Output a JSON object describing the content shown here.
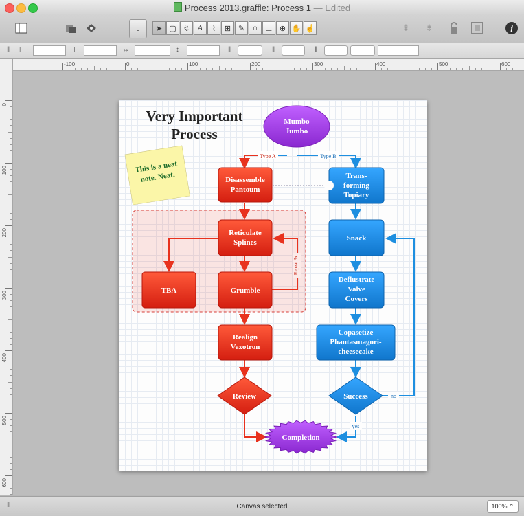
{
  "window": {
    "title": "Process 2013.graffle: Process 1",
    "title_suffix": "— Edited"
  },
  "toolbar": {
    "left_icons": [
      "sidebar-icon",
      "canvas-icon",
      "layers-icon",
      "style-icon"
    ],
    "tools": [
      "pointer",
      "shape",
      "line",
      "text",
      "pen",
      "diagram",
      "style-brush",
      "magnet",
      "rubber-stamp",
      "zoom",
      "hand",
      "browse"
    ],
    "right_icons": [
      "bring-front-icon",
      "send-back-icon",
      "lock-icon",
      "group-icon",
      "inspector-icon"
    ]
  },
  "ruler": {
    "x_labels": [
      "-100",
      "0",
      "100",
      "200",
      "300",
      "400",
      "500",
      "600"
    ],
    "y_labels": [
      "0",
      "100",
      "200",
      "300",
      "400",
      "500",
      "600"
    ]
  },
  "diagram": {
    "title_line1": "Very Important",
    "title_line2": "Process",
    "note_line1": "This is a neat",
    "note_line2": "note. Neat.",
    "nodes": {
      "mumbo1": "Mumbo",
      "mumbo2": "Jumbo",
      "disassemble1": "Disassemble",
      "disassemble2": "Pantoum",
      "trans1": "Trans-",
      "trans2": "forming",
      "trans3": "Topiary",
      "reticulate1": "Reticulate",
      "reticulate2": "Splines",
      "tba": "TBA",
      "grumble": "Grumble",
      "snack": "Snack",
      "deflustrate1": "Deflustrate",
      "deflustrate2": "Valve",
      "deflustrate3": "Covers",
      "copa1": "Copasetize",
      "copa2": "Phantasmagori-",
      "copa3": "cheesecake",
      "realign1": "Realign",
      "realign2": "Vexotron",
      "review": "Review",
      "success": "Success",
      "completion": "Completion"
    },
    "labels": {
      "type_a": "Type A",
      "type_b": "Type B",
      "repeat": "Repeat 3x",
      "no": "no",
      "yes": "yes"
    },
    "colors": {
      "red": "#e8321e",
      "blue": "#1e8fe0",
      "purple": "#a040e0",
      "note": "#fbf6a8"
    }
  },
  "status": {
    "text": "Canvas selected",
    "zoom": "100%"
  }
}
